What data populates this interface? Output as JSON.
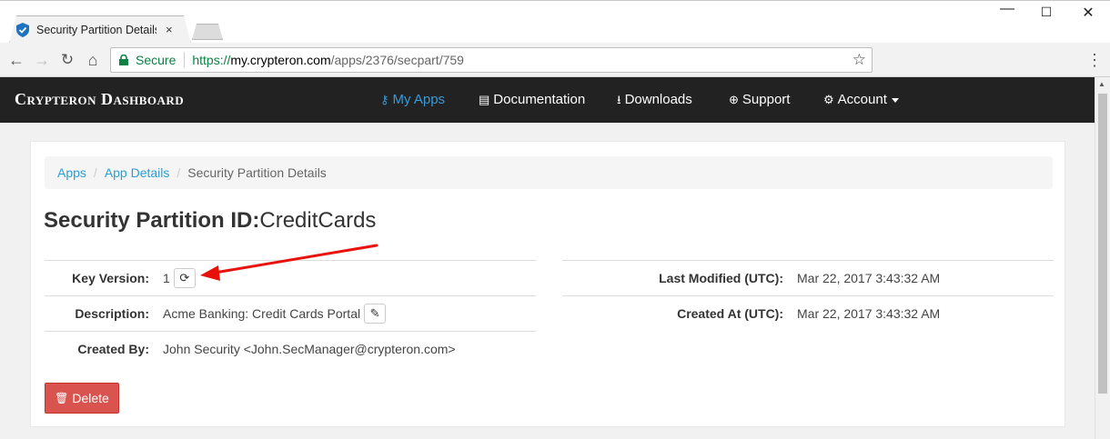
{
  "browser": {
    "tab_title": "Security Partition Details",
    "tab_close": "×",
    "window_min": "—",
    "window_max": "☐",
    "window_close": "✕",
    "back": "←",
    "forward": "→",
    "reload": "↻",
    "home": "⌂",
    "secure_label": "Secure",
    "url_scheme": "https://",
    "url_host": "my.crypteron.com",
    "url_path": "/apps/2376/secpart/759",
    "star": "☆",
    "menu": "⋮"
  },
  "navbar": {
    "brand": "Crypteron Dashboard",
    "items": [
      {
        "label": "My Apps",
        "icon": "key-icon",
        "glyph": "⚷",
        "active": true
      },
      {
        "label": "Documentation",
        "icon": "book-icon",
        "glyph": "▤"
      },
      {
        "label": "Downloads",
        "icon": "download-icon",
        "glyph": "⭳"
      },
      {
        "label": "Support",
        "icon": "lifebuoy-icon",
        "glyph": "⊕"
      },
      {
        "label": "Account",
        "icon": "gear-icon",
        "glyph": "⚙"
      }
    ]
  },
  "breadcrumb": {
    "items": [
      "Apps",
      "App Details"
    ],
    "current": "Security Partition Details",
    "separator": "/"
  },
  "heading": {
    "label": "Security Partition ID:",
    "value": "CreditCards"
  },
  "details_left": [
    {
      "label": "Key Version:",
      "value": "1",
      "action_icon": "refresh-icon",
      "action_glyph": "⟳"
    },
    {
      "label": "Description:",
      "value": "Acme Banking: Credit Cards Portal",
      "action_icon": "pencil-icon",
      "action_glyph": "✎"
    },
    {
      "label": "Created By:",
      "value": "John Security <John.SecManager@crypteron.com>"
    }
  ],
  "details_right": [
    {
      "label": "Last Modified (UTC):",
      "value": "Mar 22, 2017 3:43:32 AM"
    },
    {
      "label": "Created At (UTC):",
      "value": "Mar 22, 2017 3:43:32 AM"
    }
  ],
  "actions": {
    "delete_label": "Delete",
    "delete_glyph": "🗑"
  },
  "colors": {
    "navbar_bg": "#222222",
    "link": "#2a9fd6",
    "danger": "#d9534f",
    "annotation_arrow": "#e8120c"
  }
}
